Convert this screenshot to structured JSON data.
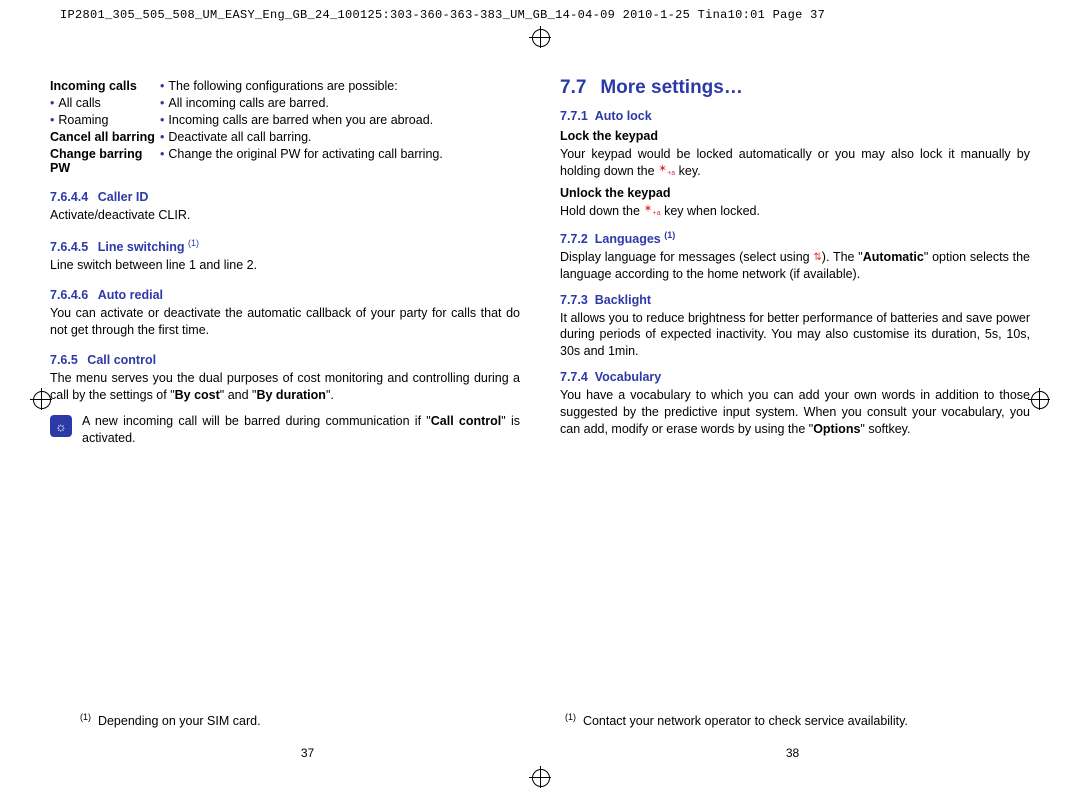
{
  "header": "IP2801_305_505_508_UM_EASY_Eng_GB_24_100125:303-360-363-383_UM_GB_14-04-09  2010-1-25  Tina10:01  Page 37",
  "left": {
    "rows": [
      {
        "lbold": true,
        "l": "Incoming calls",
        "rbullet": true,
        "r": "The following configurations are possible:"
      },
      {
        "lbold": false,
        "l": "All calls",
        "lbullet": true,
        "rbullet": true,
        "r": "All incoming calls are barred."
      },
      {
        "lbold": false,
        "l": "Roaming",
        "lbullet": true,
        "rbullet": true,
        "r": "Incoming calls are barred when you are abroad."
      },
      {
        "lbold": true,
        "l": "Cancel all barring",
        "rbullet": true,
        "r": "Deactivate all call barring."
      },
      {
        "lbold": true,
        "l": "Change barring PW",
        "rbullet": true,
        "r": "Change the original PW for activating call barring."
      }
    ],
    "s7644_num": "7.6.4.4",
    "s7644_title": "Caller ID",
    "s7644_body": "Activate/deactivate CLIR.",
    "s7645_num": "7.6.4.5",
    "s7645_title": "Line switching",
    "s7645_sup": "(1)",
    "s7645_body": "Line switch between line 1 and line 2.",
    "s7646_num": "7.6.4.6",
    "s7646_title": "Auto redial",
    "s7646_body": "You can activate or deactivate the automatic callback of your party for calls that do not get through the first time.",
    "s765_num": "7.6.5",
    "s765_title": "Call control",
    "s765_body_a": "The menu serves you the dual purposes of cost monitoring and controlling during a call by the settings of \"",
    "s765_body_b": "By cost",
    "s765_body_c": "\" and \"",
    "s765_body_d": "By duration",
    "s765_body_e": "\".",
    "tip_a": "A new incoming call will be barred during communication if \"",
    "tip_b": "Call control",
    "tip_c": "\" is activated.",
    "footnote_sup": "(1)",
    "footnote": "Depending on your SIM card.",
    "pagenum": "37"
  },
  "right": {
    "h_num": "7.7",
    "h_title": "More settings…",
    "s771_num": "7.7.1",
    "s771_title": "Auto lock",
    "lock_h": "Lock the keypad",
    "lock_body_a": "Your keypad would be locked automatically or you may also lock it manually by holding down the ",
    "lock_body_b": " key.",
    "unlock_h": "Unlock the keypad",
    "unlock_body_a": "Hold down the ",
    "unlock_body_b": " key when locked.",
    "s772_num": "7.7.2",
    "s772_title": "Languages",
    "s772_sup": "(1)",
    "s772_body_a": "Display language for messages (select using ",
    "s772_body_b": "). The \"",
    "s772_body_c": "Automatic",
    "s772_body_d": "\" option selects the language according to the home network (if available).",
    "s773_num": "7.7.3",
    "s773_title": "Backlight",
    "s773_body": "It allows you to reduce brightness for better performance of batteries and save power during periods of expected inactivity. You may also customise its duration, 5s, 10s, 30s and 1min.",
    "s774_num": "7.7.4",
    "s774_title": "Vocabulary",
    "s774_body_a": "You have a vocabulary to which you can add your own words in addition to those suggested by the predictive input system. When you consult your vocabulary, you can add, modify or erase words by using the \"",
    "s774_body_b": "Options",
    "s774_body_c": "\" softkey.",
    "footnote_sup": "(1)",
    "footnote": "Contact your network operator to check service availability.",
    "pagenum": "38"
  }
}
